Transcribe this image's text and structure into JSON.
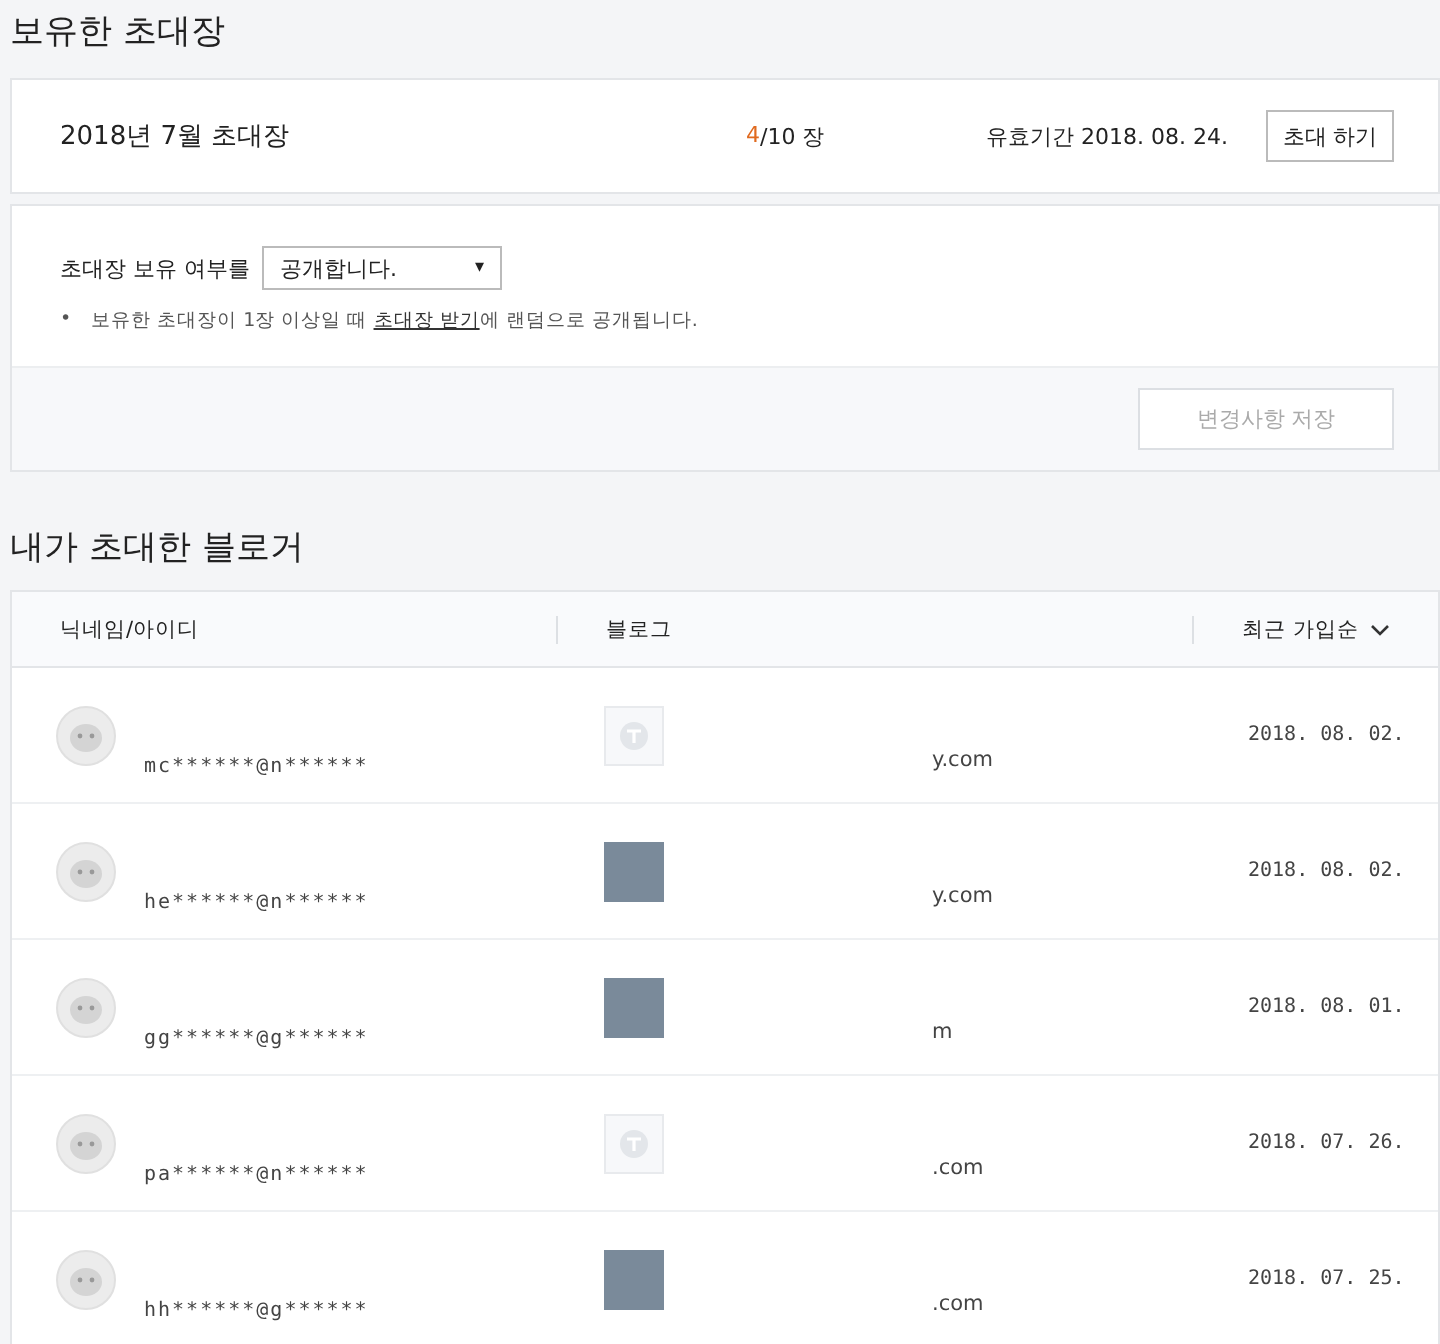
{
  "invites_section": {
    "title": "보유한 초대장"
  },
  "invite": {
    "name": "2018년 7월 초대장",
    "used": "4",
    "total": "/10 장",
    "expiry": "유효기간 2018. 08. 24.",
    "button": "초대 하기"
  },
  "settings": {
    "label": "초대장 보유 여부를",
    "dropdown": {
      "value": "공개합니다.",
      "caret": "▾"
    },
    "bullet": "•",
    "note_before": "보유한 초대장이 1장 이상일 때 ",
    "note_link": "초대장 받기",
    "note_after": "에 랜덤으로 공개됩니다.",
    "save_button": {
      "label": "변경사항 저장",
      "disabled": true
    }
  },
  "bloggers_section": {
    "title": "내가 초대한 블로거"
  },
  "table": {
    "columns": [
      "닉네임/아이디",
      "블로그"
    ],
    "sort": "최근 가입순",
    "rows": [
      {
        "id": "mc******@n******",
        "blog_thumb": {
          "kind": "default"
        },
        "blog": "y.com",
        "date": "2018. 08. 02."
      },
      {
        "id": "he******@n******",
        "blog_thumb": {
          "kind": "photo"
        },
        "blog": "y.com",
        "date": "2018. 08. 02."
      },
      {
        "id": "gg******@g******",
        "blog_thumb": {
          "kind": "photo"
        },
        "blog": "m",
        "date": "2018. 08. 01."
      },
      {
        "id": "pa******@n******",
        "blog_thumb": {
          "kind": "default"
        },
        "blog": ".com",
        "date": "2018. 07. 26."
      },
      {
        "id": "hh******@g******",
        "blog_thumb": {
          "kind": "photo"
        },
        "blog": ".com",
        "date": "2018. 07. 25."
      }
    ]
  }
}
